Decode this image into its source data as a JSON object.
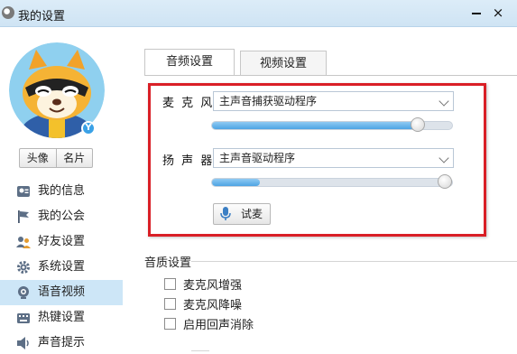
{
  "window": {
    "title": "我的设置",
    "close_glyph": "×"
  },
  "profile": {
    "badge": "Y",
    "buttons": {
      "avatar_label": "头像",
      "card_label": "名片"
    }
  },
  "sidebar": {
    "items": [
      {
        "label": "我的信息",
        "icon": "id-card-icon",
        "active": false
      },
      {
        "label": "我的公会",
        "icon": "flag-icon",
        "active": false
      },
      {
        "label": "好友设置",
        "icon": "friends-icon",
        "active": false
      },
      {
        "label": "系统设置",
        "icon": "gear-icon",
        "active": false
      },
      {
        "label": "语音视频",
        "icon": "webcam-icon",
        "active": true
      },
      {
        "label": "热键设置",
        "icon": "keyboard-icon",
        "active": false
      },
      {
        "label": "声音提示",
        "icon": "speaker-icon",
        "active": false
      }
    ]
  },
  "tabs": [
    {
      "label": "音频设置",
      "active": true
    },
    {
      "label": "视频设置",
      "active": false
    }
  ],
  "audio": {
    "microphone": {
      "label": "麦 克 风",
      "device": "主声音捕获驱动程序",
      "volume_fraction": 0.88
    },
    "speaker": {
      "label": "扬 声 器",
      "device": "主声音驱动程序",
      "volume_fraction": 0.2
    },
    "test_button_label": "试麦"
  },
  "quality": {
    "title": "音质设置",
    "options": [
      {
        "label": "麦克风增强",
        "checked": false
      },
      {
        "label": "麦克风降噪",
        "checked": false
      },
      {
        "label": "启用回声消除",
        "checked": false
      }
    ]
  },
  "colors": {
    "highlight_border": "#d91f26",
    "active_nav": "#cde6f7",
    "slider_fill": "#4ea4e3"
  }
}
